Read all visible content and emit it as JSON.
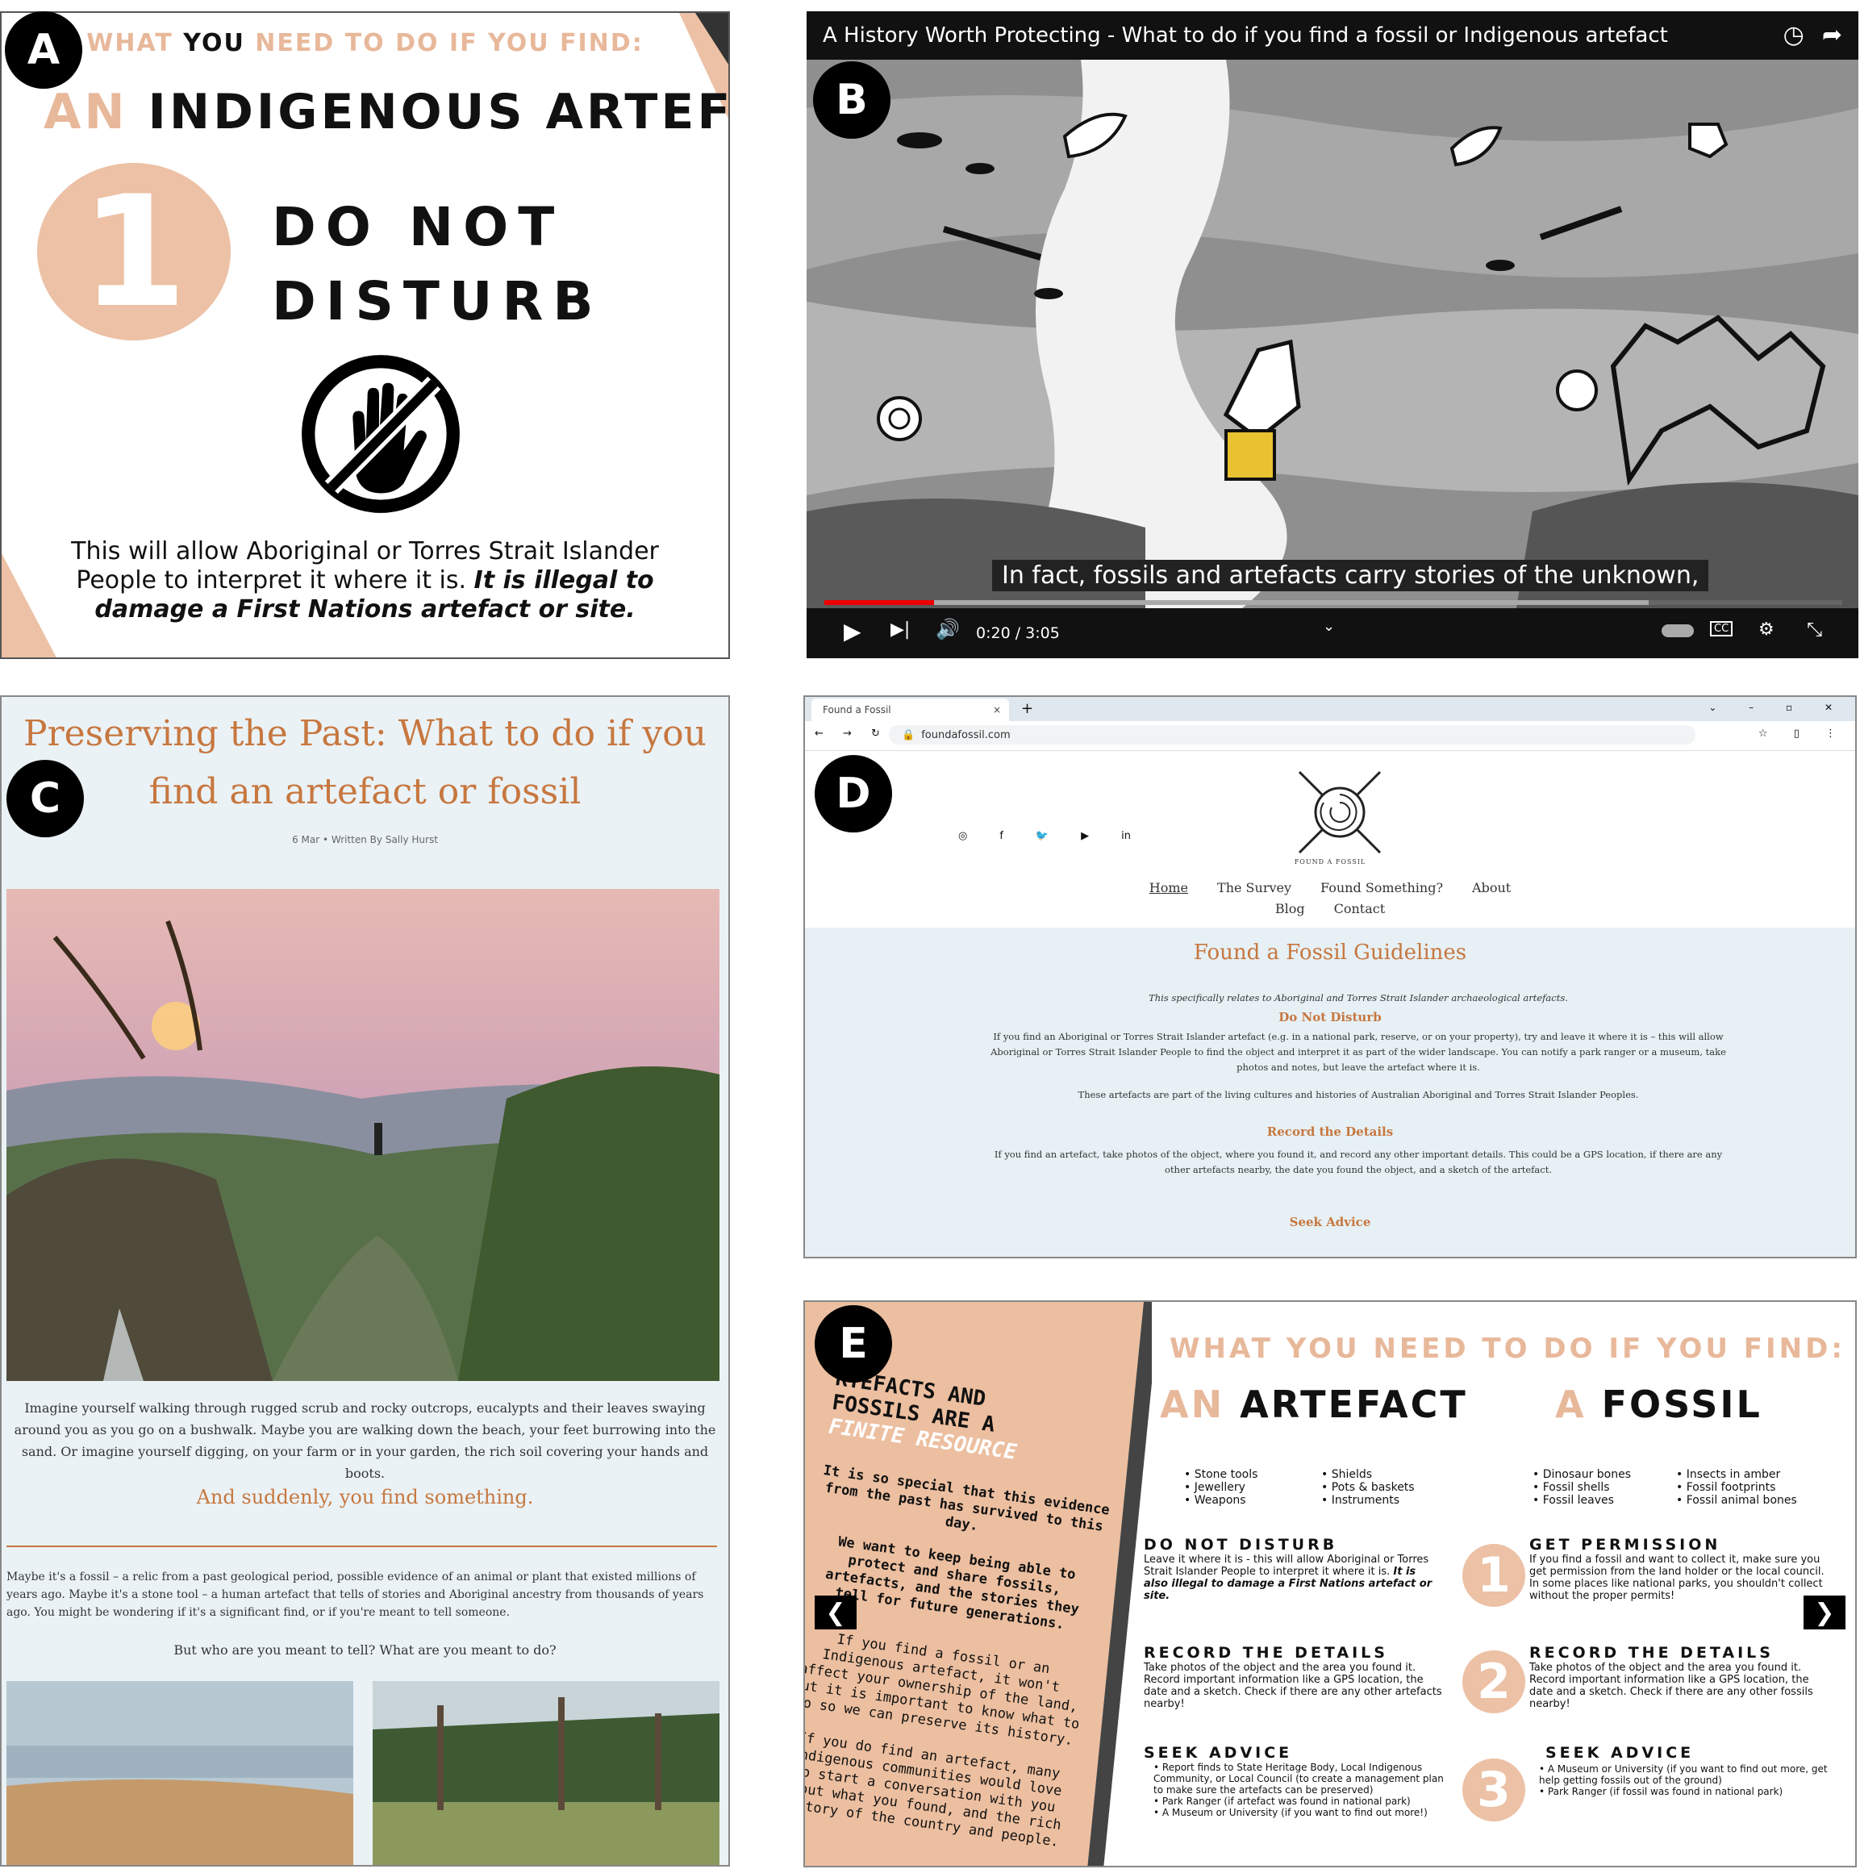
{
  "badges": {
    "a": "A",
    "b": "B",
    "c": "C",
    "d": "D",
    "e": "E"
  },
  "panel_a": {
    "kicker_1": "WHAT",
    "kicker_2": " YOU ",
    "kicker_3": "NEED TO DO IF YOU FIND:",
    "title_prefix": "AN",
    "title_main": " INDIGENOUS ARTEFACT",
    "step_number": "1",
    "step_line1": "DO NOT",
    "step_line2": "DISTURB",
    "icon": "no-touch-hand-icon",
    "body_plain": "This will allow Aboriginal or Torres Strait Islander People to interpret it where it is. ",
    "body_bold": "It is illegal to damage a First Nations artefact or site.",
    "colors": {
      "accent": "#e8b89a",
      "circle": "#ecc1a5"
    }
  },
  "panel_b": {
    "video_title": "A History Worth Protecting - What to do if you find a fossil or Indigenous artefact",
    "caption": "In fact, fossils and artefacts carry stories of the unknown,",
    "time": "0:20 / 3:05",
    "progress_fraction": 0.108,
    "buffer_fraction": 0.81,
    "icons": [
      "watch-later-icon",
      "share-icon",
      "play-icon",
      "next-icon",
      "volume-icon",
      "autoplay-toggle-icon",
      "cc-icon",
      "hd-settings-icon",
      "exit-fullscreen-icon"
    ]
  },
  "panel_c": {
    "title": "Preserving the Past: What to do if you find an artefact or fossil",
    "meta": "6 Mar  •  Written By Sally Hurst",
    "para1": "Imagine yourself walking through rugged scrub and rocky outcrops, eucalypts and their leaves swaying around you as you go on a bushwalk. Maybe you are walking down the beach, your feet burrowing into the sand. Or imagine yourself digging, on your farm or in your garden, the rich soil covering your hands and boots.",
    "subheading": "And suddenly, you find something.",
    "para2": "Maybe it's a fossil – a relic from a past geological period, possible evidence of an animal or plant that existed millions of years ago. Maybe it's a stone tool – a human artefact that tells of stories and Aboriginal ancestry from thousands of years ago. You might be wondering if it's a significant find, or if you're meant to tell someone.",
    "para3": "But who are you meant to tell? What are you meant to do?"
  },
  "panel_d": {
    "tab_title": "Found a Fossil",
    "tab_close": "×",
    "tab_new": "+",
    "url": "foundafossil.com",
    "logo_text": "FOUND A FOSSIL",
    "social_icons": [
      "instagram-icon",
      "facebook-icon",
      "twitter-icon",
      "youtube-icon",
      "linkedin-icon"
    ],
    "social_glyphs": [
      "◎",
      "f",
      "🐦",
      "▶",
      "in"
    ],
    "nav": [
      "Home",
      "The Survey",
      "Found Something?",
      "About",
      "Blog",
      "Contact"
    ],
    "heading": "Found a Fossil Guidelines",
    "intro": "This specifically relates to Aboriginal and Torres Strait Islander archaeological artefacts.",
    "h_do_not_disturb": "Do Not Disturb",
    "p_do_not_disturb": "If you find an Aboriginal or Torres Strait Islander artefact (e.g. in a national park, reserve, or on your property), try and leave it where it is – this will allow Aboriginal or Torres Strait Islander People to find the object and interpret it as part of the wider landscape. You can notify a park ranger or a museum, take photos and notes, but leave the artefact where it is.",
    "p_living": "These artefacts are part of the living cultures and histories of Australian Aboriginal and Torres Strait Islander Peoples.",
    "h_record": "Record the Details",
    "p_record": "If you find an artefact, take photos of the object, where you found it, and record any other important details. This could be a GPS location, if there are any other artefacts nearby, the date you found the object, and a sketch of the artefact.",
    "h_seek": "Seek Advice"
  },
  "panel_e": {
    "left_heading_1": "RTEFACTS AND",
    "left_heading_2": "FOSSILS ARE A",
    "left_heading_3": "FINITE RESOURCE",
    "left_p1": "It is so special that this evidence from the past has survived to this day.",
    "left_p2": "We want to keep being able to protect and share fossils, artefacts, and the stories they tell for future generations.",
    "left_p3": "If you find a fossil or an Indigenous artefact, it won't affect your ownership of the land, but it is important to know what to do so we can preserve its history.",
    "left_p4": "If you do find an artefact, many Indigenous communities would love to start a conversation with you about what you found, and the rich history of the country and people.",
    "kicker": "WHAT YOU NEED TO DO IF YOU FIND:",
    "artefact_prefix": "AN",
    "artefact_title": " ARTEFACT",
    "fossil_prefix": "A",
    "fossil_title": " FOSSIL",
    "artefact_list_a": [
      "Stone tools",
      "Jewellery",
      "Weapons"
    ],
    "artefact_list_b": [
      "Shields",
      "Pots & baskets",
      "Instruments"
    ],
    "fossil_list_a": [
      "Dinosaur bones",
      "Fossil shells",
      "Fossil leaves"
    ],
    "fossil_list_b": [
      "Insects in amber",
      "Fossil footprints",
      "Fossil animal bones"
    ],
    "a_h1": "DO NOT DISTURB",
    "a_p1": "Leave it where it is - this will allow Aboriginal or Torres Strait Islander People to interpret it where it is.",
    "a_p1_bold": "It is also illegal to damage a First Nations artefact or site.",
    "a_h2": "RECORD THE DETAILS",
    "a_p2": "Take photos of the object and the area you found it. Record important information like a GPS location, the date and a sketch. Check if there are any other artefacts nearby!",
    "a_h3": "SEEK ADVICE",
    "a_p3_items": [
      "Report finds to State Heritage Body, Local Indigenous Community, or Local Council (to create a management plan to make sure the artefacts can be preserved)",
      "Park Ranger (if artefact was found in national park)",
      "A Museum or University (if you want to find out more!)"
    ],
    "f_h1": "GET PERMISSION",
    "f_p1": "If you find a fossil and want to collect it, make sure you get permission from the land holder or the local council. In some places like national parks, you shouldn't collect without the proper permits!",
    "f_h2": "RECORD THE DETAILS",
    "f_p2": "Take photos of the object and the area you found it. Record important information like a GPS location, the date and a sketch. Check if there are any other fossils nearby!",
    "f_h3": "SEEK ADVICE",
    "f_p3_items": [
      "A Museum or University (if you want to find out more, get help getting fossils out of the ground)",
      "Park Ranger (if fossil was found in national park)"
    ],
    "numbers": [
      "1",
      "2",
      "3"
    ],
    "prev_arrow": "❮",
    "next_arrow": "❯"
  }
}
